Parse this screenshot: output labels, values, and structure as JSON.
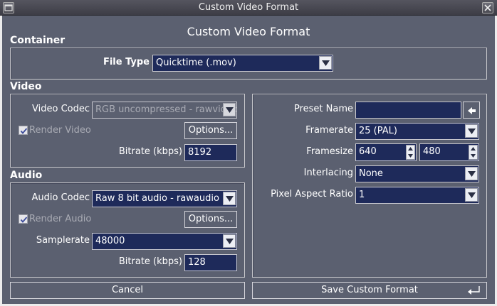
{
  "window": {
    "title": "Custom Video Format"
  },
  "dialog": {
    "heading": "Custom Video Format"
  },
  "container": {
    "section_label": "Container",
    "file_type_label": "File Type",
    "file_type_value": "Quicktime (.mov)"
  },
  "video": {
    "section_label": "Video",
    "codec_label": "Video Codec",
    "codec_value": "RGB uncompressed - rawvideo",
    "render_label": "Render Video",
    "render_checked": true,
    "options_label": "Options...",
    "bitrate_label": "Bitrate (kbps)",
    "bitrate_value": "8192"
  },
  "audio": {
    "section_label": "Audio",
    "codec_label": "Audio Codec",
    "codec_value": "Raw 8 bit audio - rawaudio",
    "render_label": "Render Audio",
    "render_checked": true,
    "options_label": "Options...",
    "samplerate_label": "Samplerate",
    "samplerate_value": "48000",
    "bitrate_label": "Bitrate (kbps)",
    "bitrate_value": "128"
  },
  "preset": {
    "name_label": "Preset Name",
    "name_value": "",
    "framerate_label": "Framerate",
    "framerate_value": "25 (PAL)",
    "framesize_label": "Framesize",
    "width_value": "640",
    "height_value": "480",
    "interlacing_label": "Interlacing",
    "interlacing_value": "None",
    "par_label": "Pixel Aspect Ratio",
    "par_value": "1"
  },
  "actions": {
    "cancel_label": "Cancel",
    "save_label": "Save Custom Format"
  },
  "icons": {
    "window_menu": "window-menu-icon",
    "close": "close-icon",
    "dropdown": "triangle-down-icon",
    "spin_up": "triangle-up-icon",
    "spin_down": "triangle-down-icon",
    "preset_add": "arrow-left-icon",
    "enter": "enter-return-icon",
    "checkbox": "check-icon"
  },
  "colors": {
    "window_bg": "#5b6070",
    "field_bg": "#1e2a5a",
    "disabled_text": "#a9abb4"
  }
}
